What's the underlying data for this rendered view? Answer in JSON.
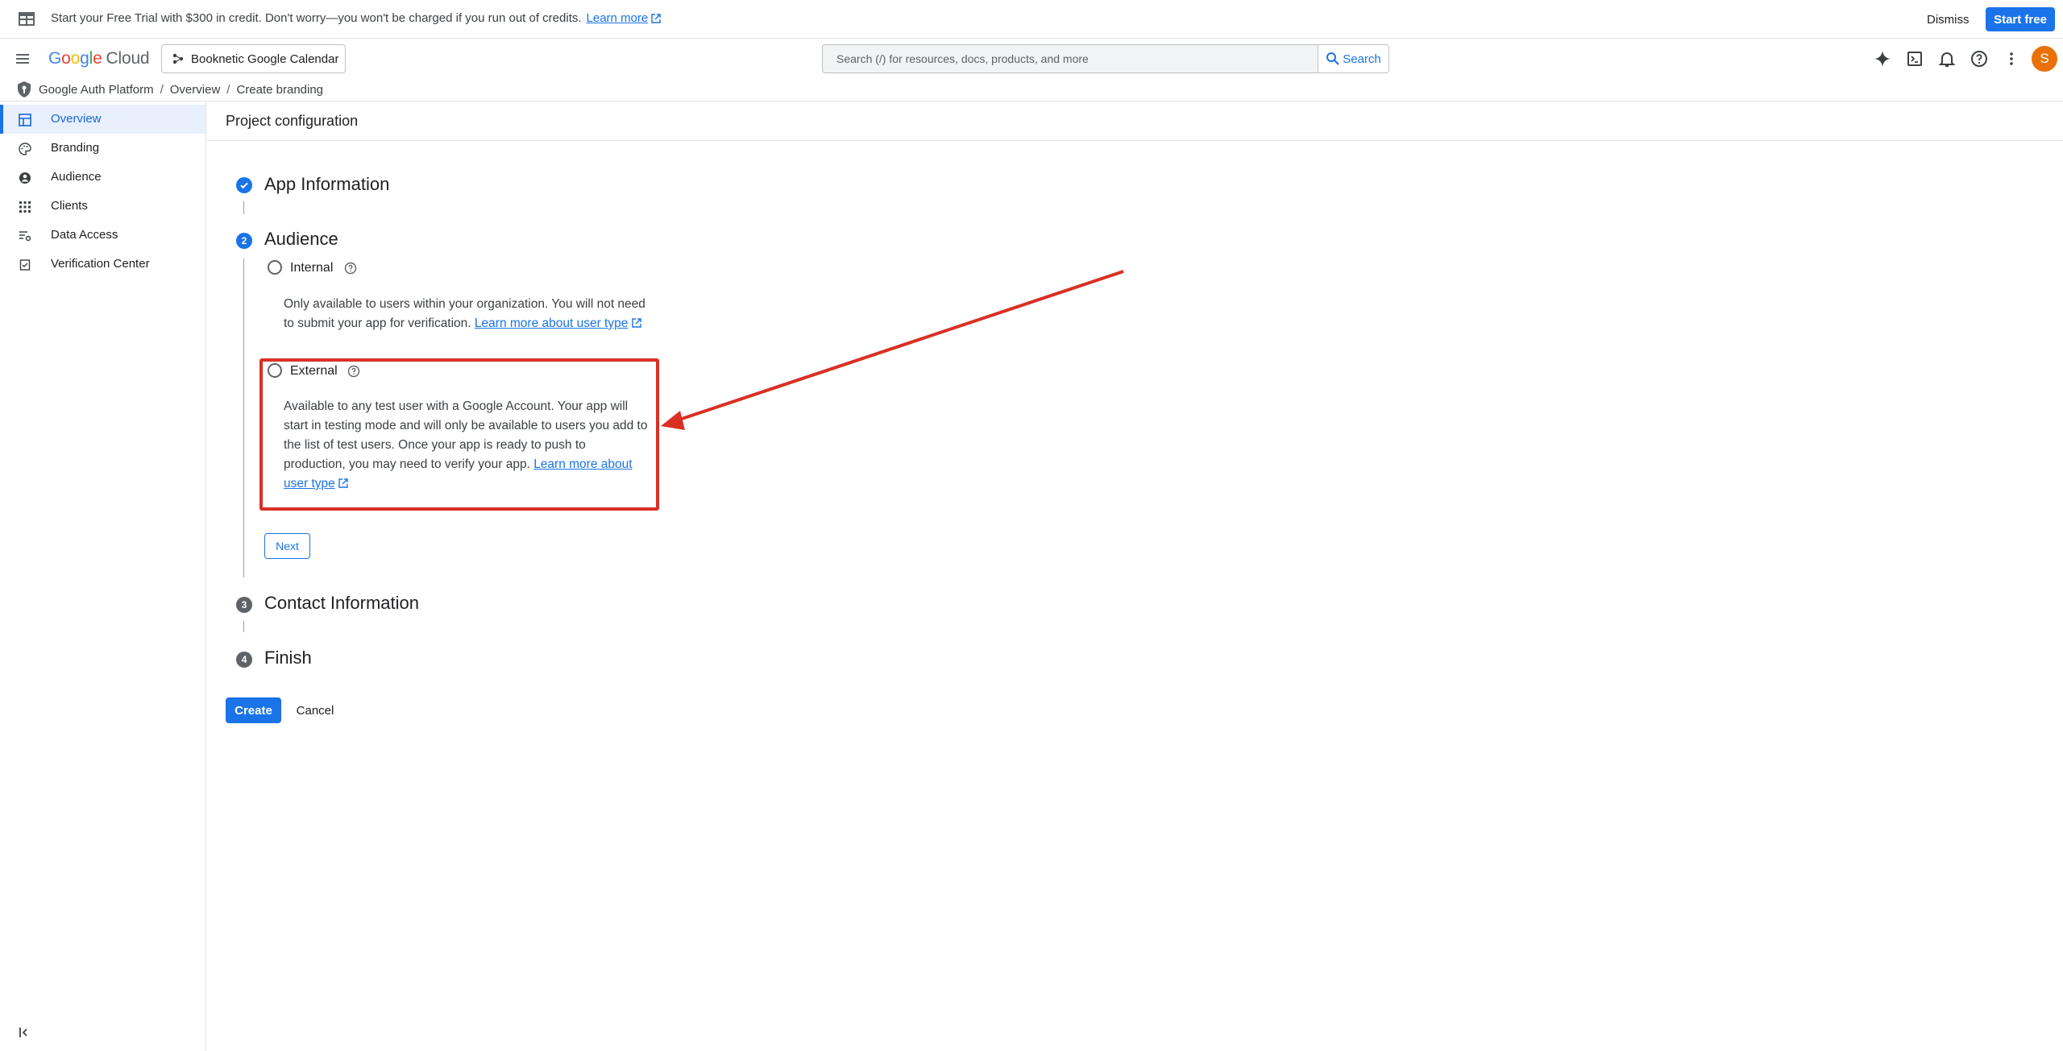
{
  "banner": {
    "text": "Start your Free Trial with $300 in credit. Don't worry—you won't be charged if you run out of credits.",
    "learn_more": "Learn more",
    "dismiss": "Dismiss",
    "start_free": "Start free"
  },
  "header": {
    "logo_google": [
      "G",
      "o",
      "o",
      "g",
      "l",
      "e"
    ],
    "logo_cloud": "Cloud",
    "project": "Booknetic Google Calendar",
    "search_placeholder": "Search (/) for resources, docs, products, and more",
    "search_button": "Search",
    "avatar_letter": "S"
  },
  "breadcrumb": {
    "items": [
      "Google Auth Platform",
      "Overview",
      "Create branding"
    ],
    "separator": "/"
  },
  "sidebar": {
    "items": [
      {
        "label": "Overview",
        "icon": "dashboard-icon",
        "active": true
      },
      {
        "label": "Branding",
        "icon": "palette-icon",
        "active": false
      },
      {
        "label": "Audience",
        "icon": "person-icon",
        "active": false
      },
      {
        "label": "Clients",
        "icon": "apps-grid-icon",
        "active": false
      },
      {
        "label": "Data Access",
        "icon": "data-access-icon",
        "active": false
      },
      {
        "label": "Verification Center",
        "icon": "verification-icon",
        "active": false
      }
    ]
  },
  "main": {
    "page_title": "Project configuration",
    "steps": [
      {
        "number": "1",
        "label": "App Information",
        "state": "done"
      },
      {
        "number": "2",
        "label": "Audience",
        "state": "current"
      },
      {
        "number": "3",
        "label": "Contact Information",
        "state": "todo"
      },
      {
        "number": "4",
        "label": "Finish",
        "state": "todo"
      }
    ],
    "options": {
      "internal": {
        "label": "Internal",
        "desc": "Only available to users within your organization. You will not need to submit your app for verification.",
        "link": "Learn more about user type"
      },
      "external": {
        "label": "External",
        "desc": "Available to any test user with a Google Account. Your app will start in testing mode and will only be available to users you add to the list of test users. Once your app is ready to push to production, you may need to verify your app.",
        "link": "Learn more about user type"
      }
    },
    "next": "Next",
    "create": "Create",
    "cancel": "Cancel"
  },
  "colors": {
    "accent": "#1a73e8",
    "annotation": "#d93025",
    "avatar": "#e8710a"
  }
}
